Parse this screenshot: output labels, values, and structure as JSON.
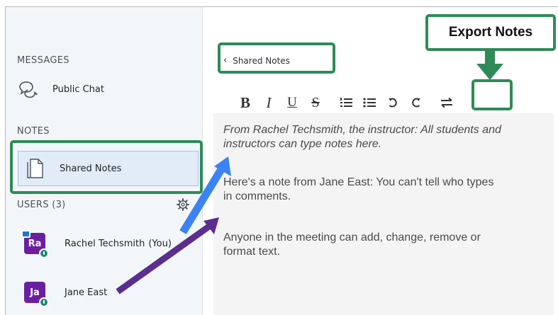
{
  "sidebar": {
    "messages_title": "MESSAGES",
    "public_chat_label": "Public Chat",
    "notes_title": "NOTES",
    "shared_notes_label": "Shared Notes",
    "users_title": "USERS (3)",
    "users": [
      {
        "initials": "Ra",
        "name": "Rachel Techsmith",
        "suffix": "(You)",
        "avatar_color": "#6b1fa0"
      },
      {
        "initials": "Ja",
        "name": "Jane East",
        "suffix": "",
        "avatar_color": "#6b1fa0"
      }
    ]
  },
  "main": {
    "back_label": "Shared Notes",
    "toolbar": [
      "B",
      "I",
      "U",
      "S",
      "numbered-list",
      "bullet-list",
      "undo",
      "redo",
      "export"
    ],
    "notes": [
      "From Rachel Techsmith, the instructor: All students and instructors can type notes here.",
      "Here's a note from Jane East: You can't tell who types in comments.",
      "Anyone in the meeting can add, change, remove or format text."
    ]
  },
  "annotations": {
    "export_label": "Export Notes",
    "highlight_color": "#2e8b57",
    "arrow_colors": [
      "#3b82f6",
      "#5b2d8f"
    ]
  }
}
